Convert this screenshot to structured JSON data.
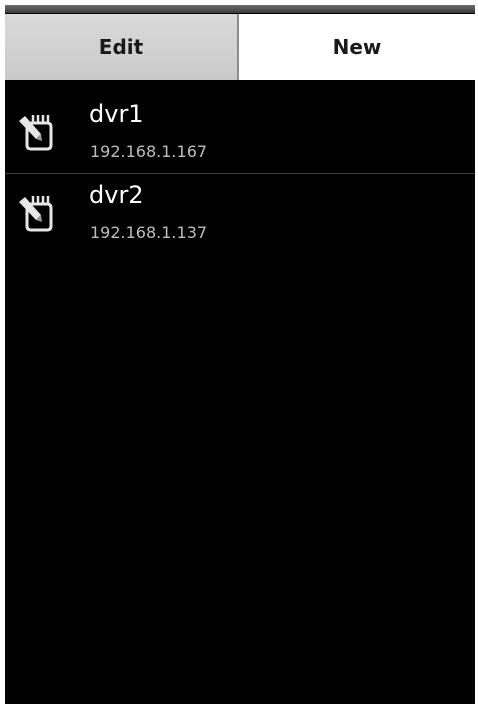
{
  "tabs": {
    "edit_label": "Edit",
    "new_label": "New"
  },
  "devices": [
    {
      "name": "dvr1",
      "address": "192.168.1.167",
      "icon": "edit-note-icon"
    },
    {
      "name": "dvr2",
      "address": "192.168.1.137",
      "icon": "edit-note-icon"
    }
  ],
  "colors": {
    "background": "#000000",
    "tab_active": "#ffffff",
    "tab_inactive": "#d0d0d0",
    "text_primary": "#ffffff",
    "text_secondary": "#bdbdbd"
  }
}
